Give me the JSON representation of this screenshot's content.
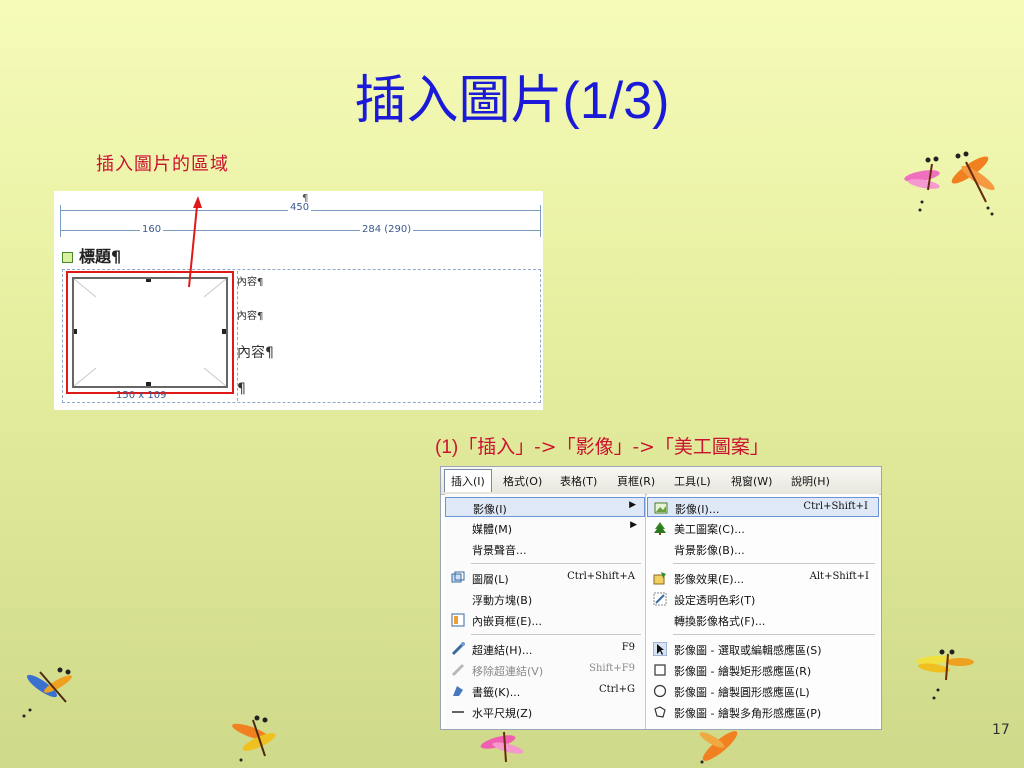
{
  "slide": {
    "title": "插入圖片",
    "title_suffix": "(1/3)",
    "annotation": "插入圖片的區域",
    "step_number": "(1)",
    "step_text": "「插入」->「影像」->「美工圖案」",
    "page_number": "17"
  },
  "editor": {
    "pilcrow": "¶",
    "width_total": "450",
    "width_left": "160",
    "width_right": "284 (290)",
    "heading": "標題¶",
    "content_small_1": "內容¶",
    "content_small_2": "內容¶",
    "content_large": "內容¶",
    "pilcrow_last": "¶",
    "image_size": "150 x 109"
  },
  "menubar": {
    "items": [
      "插入(I)",
      "格式(O)",
      "表格(T)",
      "頁框(R)",
      "工具(L)",
      "視窗(W)",
      "說明(H)"
    ]
  },
  "left_menu": {
    "items": [
      {
        "label": "影像(I)",
        "shortcut": "",
        "submenu": true,
        "highlighted": true
      },
      {
        "label": "媒體(M)",
        "shortcut": "",
        "submenu": true
      },
      {
        "label": "背景聲音...",
        "shortcut": ""
      },
      {
        "label": "圖層(L)",
        "shortcut": "Ctrl+Shift+A"
      },
      {
        "label": "浮動方塊(B)",
        "shortcut": ""
      },
      {
        "label": "內嵌頁框(E)...",
        "shortcut": ""
      },
      {
        "label": "超連結(H)...",
        "shortcut": "F9"
      },
      {
        "label": "移除超連結(V)",
        "shortcut": "Shift+F9",
        "disabled": true
      },
      {
        "label": "書籤(K)...",
        "shortcut": "Ctrl+G"
      },
      {
        "label": "水平尺規(Z)",
        "shortcut": ""
      }
    ]
  },
  "right_menu": {
    "items": [
      {
        "label": "影像(I)...",
        "shortcut": "Ctrl+Shift+I",
        "highlighted": true
      },
      {
        "label": "美工圖案(C)...",
        "shortcut": ""
      },
      {
        "label": "背景影像(B)...",
        "shortcut": ""
      },
      {
        "label": "影像效果(E)...",
        "shortcut": "Alt+Shift+I"
      },
      {
        "label": "設定透明色彩(T)",
        "shortcut": ""
      },
      {
        "label": "轉換影像格式(F)...",
        "shortcut": ""
      },
      {
        "label": "影像圖 - 選取或編輯感應區(S)",
        "shortcut": ""
      },
      {
        "label": "影像圖 - 繪製矩形感應區(R)",
        "shortcut": ""
      },
      {
        "label": "影像圖 - 繪製圓形感應區(L)",
        "shortcut": ""
      },
      {
        "label": "影像圖 - 繪製多角形感應區(P)",
        "shortcut": ""
      }
    ]
  },
  "colors": {
    "title": "#1a1ad8",
    "annotation": "#cc1030",
    "highlight": "#dfe8f6",
    "image_border": "#e01818"
  }
}
